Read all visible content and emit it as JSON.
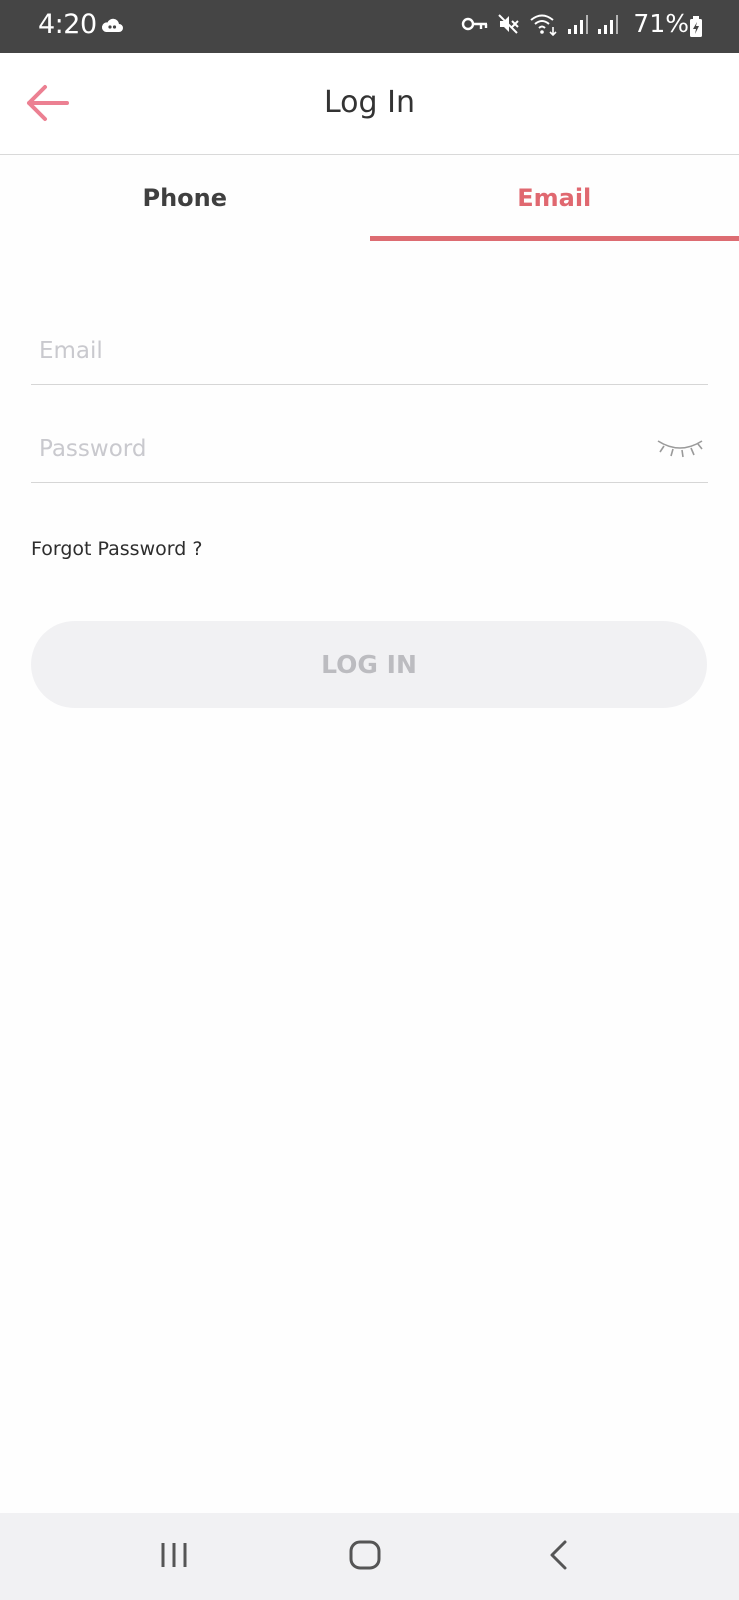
{
  "status_bar": {
    "time": "4:20",
    "battery": "71%",
    "icons": [
      "cloud-icon",
      "vpn-key-icon",
      "mute-icon",
      "wifi-icon",
      "signal-icon",
      "signal-icon",
      "battery-icon"
    ]
  },
  "app_bar": {
    "title": "Log In",
    "back_icon": "arrow-left-icon"
  },
  "tabs": [
    {
      "label": "Phone",
      "active": false
    },
    {
      "label": "Email",
      "active": true
    }
  ],
  "form": {
    "email": {
      "value": "",
      "placeholder": "Email"
    },
    "password": {
      "value": "",
      "placeholder": "Password",
      "toggle_icon": "eye-closed-icon"
    },
    "forgot_password": "Forgot Password ?",
    "login_button": "LOG IN"
  },
  "nav_bar": {
    "icons": [
      "recents-icon",
      "home-icon",
      "back-icon"
    ]
  },
  "colors": {
    "accent": "#dd6c72",
    "status_bar": "#454545",
    "button_bg": "#f1f1f3",
    "button_text": "#bcbcc0",
    "placeholder": "#c9c9ce"
  }
}
